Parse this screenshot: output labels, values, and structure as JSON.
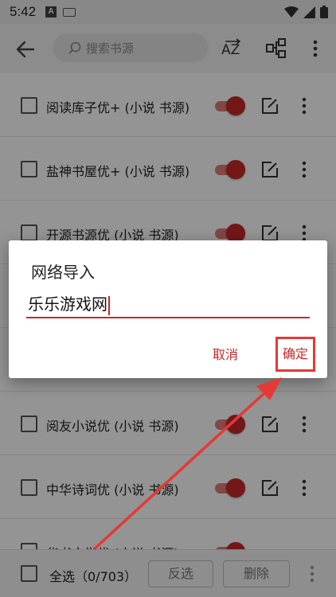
{
  "status_bar": {
    "time": "5:42",
    "notif_letter": "A"
  },
  "toolbar": {
    "search_placeholder": "搜索书源"
  },
  "list": {
    "rows": [
      {
        "label": "阅读库子优+ (小说 书源)"
      },
      {
        "label": "盐神书屋优+ (小说 书源)"
      },
      {
        "label": "开源书源优 (小说 书源)"
      },
      {
        "label": ""
      },
      {
        "label": ""
      },
      {
        "label": "阅友小说优 (小说 书源)"
      },
      {
        "label": "中华诗词优 (小说 书源)"
      },
      {
        "label": "华书文学优 (小说 书源)"
      }
    ]
  },
  "bottom_bar": {
    "select_all": "全选（0/703）",
    "invert": "反选",
    "delete": "删除"
  },
  "dialog": {
    "title": "网络导入",
    "input_value": "乐乐游戏网",
    "cancel": "取消",
    "confirm": "确定"
  },
  "colors": {
    "accent": "#c62828",
    "annotation": "#e53935"
  }
}
